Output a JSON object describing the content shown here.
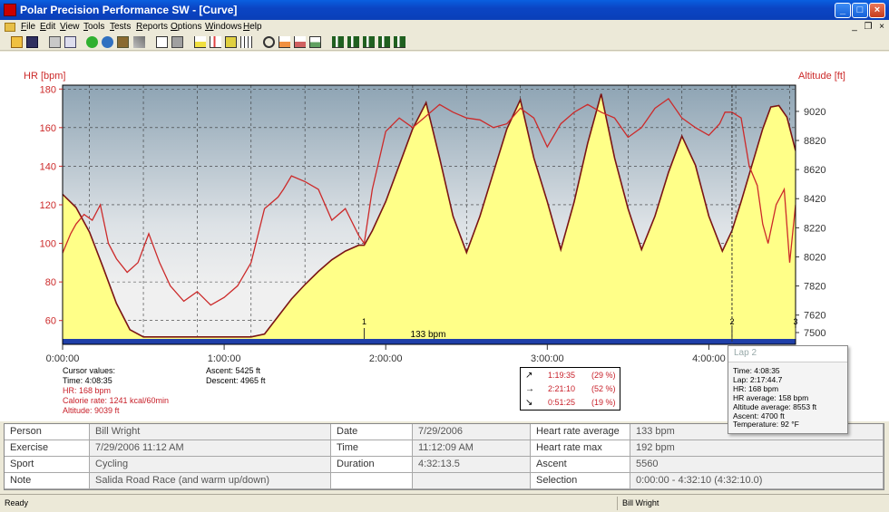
{
  "window": {
    "title": "Polar Precision Performance SW - [Curve]",
    "buttons": [
      "_",
      "□",
      "×"
    ],
    "mdi_buttons": [
      "_",
      "❐",
      "×"
    ]
  },
  "menu": [
    "File",
    "Edit",
    "View",
    "Tools",
    "Tests",
    "Reports",
    "Options",
    "Windows",
    "Help"
  ],
  "toolbar_icons": [
    "open-folder-icon",
    "save-icon",
    "print-icon",
    "copy-icon",
    "sync-icon",
    "globe-icon",
    "wand-icon",
    "window-icon",
    "book-icon",
    "area-chart-icon",
    "bar-chart-icon",
    "compare-chart-icon",
    "grid-icon",
    "zoom-icon",
    "chart-settings-icon",
    "chart-edit-icon",
    "chart-export-icon",
    "stat-chart-1-icon",
    "stat-chart-2-icon",
    "stat-chart-3-icon",
    "stat-chart-4-icon"
  ],
  "colors": {
    "hr_line": "#cc2a2a",
    "altitude_fill": "#ffff88",
    "altitude_line": "#7a1414",
    "zone_bar": "#1f3fa8",
    "plot_top": "#8ea4b4",
    "plot_mid": "#e8e8e8"
  },
  "chart_data": {
    "type": "line",
    "ylabel": "HR [bpm]",
    "ylabel_right": "Altitude [ft]",
    "y_ticks": [
      "180",
      "160",
      "140",
      "120",
      "100",
      "80",
      "60"
    ],
    "y_range": [
      50,
      182
    ],
    "y2_ticks": [
      "9020",
      "8820",
      "8620",
      "8420",
      "8220",
      "8020",
      "7820",
      "7620",
      "7500"
    ],
    "y2_range": [
      7450,
      9200
    ],
    "x_ticks": [
      "0:00:00",
      "1:00:00",
      "2:00:00",
      "3:00:00",
      "4:00:00"
    ],
    "x_range_min": [
      0,
      272.2
    ],
    "x_tick_min": [
      0,
      60,
      120,
      180,
      240
    ],
    "zone_label": "133 bpm",
    "zone_value": 133,
    "lap_markers": [
      {
        "label": "1",
        "min": 112
      },
      {
        "label": "2",
        "min": 248.6
      },
      {
        "label": "3",
        "min": 272.2
      }
    ],
    "cursor_min": 248.6,
    "series": [
      {
        "name": "HR",
        "unit": "bpm",
        "x": [
          0,
          3,
          5,
          8,
          11,
          14,
          17,
          20,
          24,
          28,
          32,
          36,
          40,
          45,
          50,
          55,
          60,
          65,
          70,
          75,
          80,
          82,
          85,
          90,
          95,
          100,
          105,
          110,
          112,
          115,
          120,
          125,
          130,
          135,
          140,
          145,
          150,
          155,
          160,
          165,
          170,
          175,
          180,
          185,
          190,
          195,
          200,
          205,
          210,
          215,
          220,
          225,
          230,
          235,
          240,
          244,
          246,
          248.6,
          252,
          255,
          258,
          260,
          262,
          265,
          268,
          270,
          272.2
        ],
        "y": [
          95,
          105,
          110,
          115,
          112,
          120,
          100,
          92,
          85,
          90,
          105,
          90,
          78,
          70,
          75,
          68,
          72,
          78,
          90,
          118,
          124,
          128,
          135,
          132,
          128,
          112,
          118,
          104,
          100,
          128,
          158,
          165,
          160,
          166,
          172,
          168,
          165,
          164,
          160,
          162,
          170,
          165,
          150,
          162,
          168,
          172,
          168,
          165,
          155,
          160,
          170,
          175,
          165,
          160,
          156,
          162,
          168,
          168,
          165,
          140,
          130,
          110,
          100,
          120,
          128,
          90,
          120
        ]
      },
      {
        "name": "Altitude",
        "unit": "ft",
        "x": [
          0,
          5,
          10,
          15,
          20,
          25,
          30,
          35,
          40,
          45,
          50,
          55,
          60,
          65,
          70,
          75,
          80,
          85,
          90,
          95,
          100,
          105,
          110,
          112,
          115,
          120,
          125,
          130,
          135,
          140,
          145,
          150,
          155,
          160,
          165,
          170,
          175,
          180,
          185,
          190,
          195,
          200,
          205,
          210,
          215,
          220,
          225,
          230,
          235,
          240,
          245,
          248.6,
          252,
          256,
          260,
          263,
          266,
          269,
          272.2
        ],
        "y": [
          8450,
          8360,
          8190,
          7950,
          7700,
          7520,
          7470,
          7470,
          7470,
          7470,
          7470,
          7470,
          7470,
          7470,
          7470,
          7490,
          7610,
          7730,
          7830,
          7920,
          8000,
          8060,
          8100,
          8100,
          8200,
          8400,
          8650,
          8900,
          9080,
          8700,
          8300,
          8050,
          8300,
          8600,
          8900,
          9100,
          8700,
          8400,
          8070,
          8400,
          8800,
          9140,
          8700,
          8350,
          8070,
          8300,
          8600,
          8850,
          8650,
          8300,
          8060,
          8200,
          8400,
          8650,
          8900,
          9050,
          9060,
          8980,
          8750
        ]
      }
    ]
  },
  "cursor_values": {
    "title": "Cursor values:",
    "time": "Time: 4:08:35",
    "hr": "HR: 168 bpm",
    "calorie": "Calorie rate: 1241 kcal/60min",
    "altitude": "Altitude: 9039 ft",
    "ascent": "Ascent: 5425 ft",
    "descent": "Descent: 4965 ft"
  },
  "zones": [
    {
      "arrow": "↗",
      "time": "1:19:35",
      "pct": "(29 %)"
    },
    {
      "arrow": "→",
      "time": "2:21:10",
      "pct": "(52 %)"
    },
    {
      "arrow": "↘",
      "time": "0:51:25",
      "pct": "(19 %)"
    }
  ],
  "lap_tooltip": {
    "title": "Lap 2",
    "lines": [
      "Time: 4:08:35",
      "Lap: 2:17:44.7",
      "HR: 168 bpm",
      "HR average:  158 bpm",
      "Altitude average:  8553 ft",
      "Ascent:  4700 ft",
      "Temperature: 92 °F"
    ]
  },
  "info_table": [
    [
      "Person",
      "Bill Wright",
      "Date",
      "7/29/2006",
      "Heart rate average",
      "133 bpm"
    ],
    [
      "Exercise",
      "7/29/2006 11:12 AM",
      "Time",
      "11:12:09 AM",
      "Heart rate max",
      "192 bpm"
    ],
    [
      "Sport",
      "Cycling",
      "Duration",
      "4:32:13.5",
      "Ascent",
      "5560"
    ],
    [
      "Note",
      "Salida Road Race (and warm up/down)",
      "",
      "",
      "Selection",
      "0:00:00 - 4:32:10 (4:32:10.0)"
    ]
  ],
  "status": {
    "left": "Ready",
    "user": "Bill Wright"
  }
}
